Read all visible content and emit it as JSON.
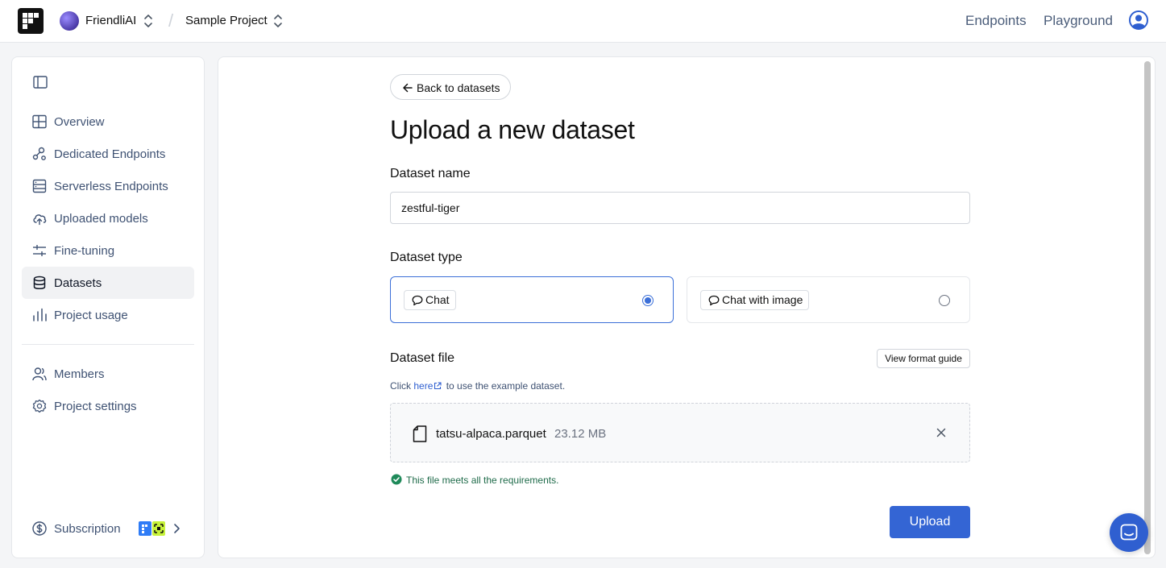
{
  "header": {
    "org_name": "FriendliAI",
    "project_name": "Sample Project",
    "nav": [
      "Endpoints",
      "Playground"
    ]
  },
  "sidebar": {
    "items": [
      {
        "label": "Overview",
        "icon": "layout-icon"
      },
      {
        "label": "Dedicated Endpoints",
        "icon": "nodes-icon"
      },
      {
        "label": "Serverless Endpoints",
        "icon": "server-icon"
      },
      {
        "label": "Uploaded models",
        "icon": "cloud-upload-icon"
      },
      {
        "label": "Fine-tuning",
        "icon": "sliders-icon"
      },
      {
        "label": "Datasets",
        "icon": "database-icon",
        "active": true
      },
      {
        "label": "Project usage",
        "icon": "bar-chart-icon"
      },
      {
        "label": "Members",
        "icon": "users-icon"
      },
      {
        "label": "Project settings",
        "icon": "gear-icon"
      },
      {
        "label": "Subscription",
        "icon": "dollar-icon"
      }
    ]
  },
  "main": {
    "back_label": "Back to datasets",
    "title": "Upload a new dataset",
    "dataset_name_label": "Dataset name",
    "dataset_name_value": "zestful-tiger",
    "dataset_type_label": "Dataset type",
    "types": [
      {
        "label": "Chat",
        "selected": true
      },
      {
        "label": "Chat with image",
        "selected": false
      }
    ],
    "dataset_file_label": "Dataset file",
    "format_guide_label": "View format guide",
    "hint_prefix": "Click",
    "hint_link": "here",
    "hint_suffix": "to use the example dataset.",
    "file": {
      "name": "tatsu-alpaca.parquet",
      "size": "23.12 MB"
    },
    "status_text": "This file meets all the requirements.",
    "upload_label": "Upload"
  },
  "colors": {
    "accent": "#3465d4",
    "success": "#1f6b4a",
    "selected_border": "#3b6fd8"
  }
}
